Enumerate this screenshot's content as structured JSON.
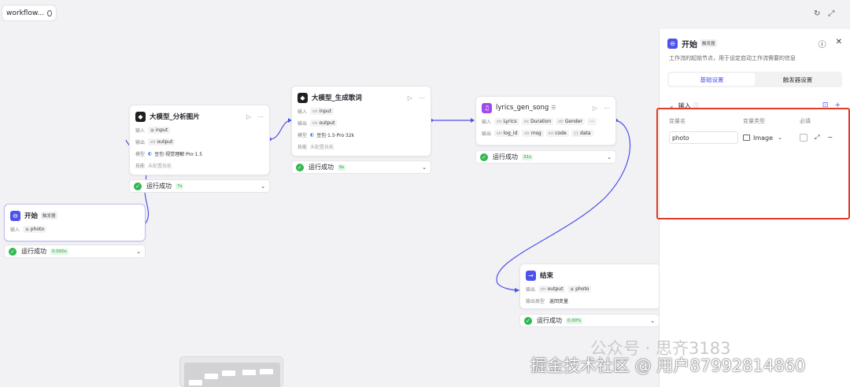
{
  "app": {
    "tab_title": "workflow..."
  },
  "common": {
    "input_label": "输入",
    "output_label": "输出",
    "model_label": "模型",
    "skill_label": "技能",
    "status_text": "运行成功"
  },
  "nodes": {
    "start": {
      "title": "开始",
      "badge": "触发器",
      "inputs": [
        "photo"
      ],
      "time": "0.000s"
    },
    "analyze": {
      "title": "大模型_分析图片",
      "inputs": [
        "input"
      ],
      "outputs": [
        "output"
      ],
      "model": "豆包·视觉理解·Pro·1.5",
      "skill": "未配置技能",
      "time": "7s"
    },
    "lyrics": {
      "title": "大模型_生成歌词",
      "inputs": [
        "input"
      ],
      "outputs": [
        "output"
      ],
      "model": "豆包·1.5·Pro·32k",
      "skill": "未配置技能",
      "time": "9s"
    },
    "song": {
      "title": "lyrics_gen_song",
      "inputs": [
        "Lyrics",
        "Duration",
        "Gender"
      ],
      "outputs": [
        "log_id",
        "msg",
        "code",
        "data"
      ],
      "time": "31s"
    },
    "end": {
      "title": "结束",
      "outputs": [
        "output",
        "photo"
      ],
      "output_type_label": "输出类型",
      "output_type": "返回变量",
      "time": "0.00%"
    }
  },
  "panel": {
    "title": "开始",
    "badge": "触发器",
    "description": "工作流的起始节点，用于设定启动工作流需要的信息",
    "tabs": [
      "基础设置",
      "触发器设置"
    ],
    "section_title": "输入",
    "columns": [
      "变量名",
      "变量类型",
      "必填"
    ],
    "field": {
      "name": "photo",
      "type": "Image"
    }
  },
  "watermark": {
    "line1": "公众号 · 思齐3183",
    "line2": "掘金技术社区 @ 用户87992814860"
  },
  "colors": {
    "accent": "#4d53e8",
    "success": "#2fb84f",
    "highlight_box": "#e53a25"
  },
  "icons": [
    "refresh-icon",
    "fullscreen-icon",
    "help-icon",
    "close-icon",
    "run-icon",
    "more-icon",
    "success-check-icon",
    "chevron-down-icon",
    "add-icon"
  ]
}
